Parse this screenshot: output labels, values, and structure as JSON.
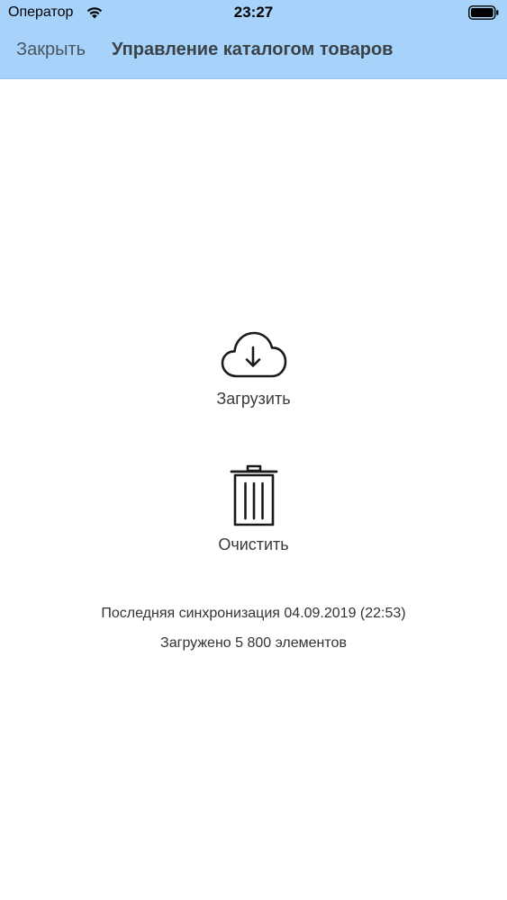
{
  "status_bar": {
    "carrier": "Оператор",
    "time": "23:27",
    "icons": [
      "wifi-icon",
      "battery-icon"
    ]
  },
  "nav": {
    "close_label": "Закрыть",
    "title": "Управление каталогом товаров",
    "background": "#a7d3fb"
  },
  "actions": {
    "download": {
      "label": "Загрузить",
      "icon": "cloud-download-icon"
    },
    "clear": {
      "label": "Очистить",
      "icon": "trash-icon"
    }
  },
  "info": {
    "last_sync": "Последняя синхронизация 04.09.2019 (22:53)",
    "loaded_count": "Загружено 5 800 элементов"
  }
}
